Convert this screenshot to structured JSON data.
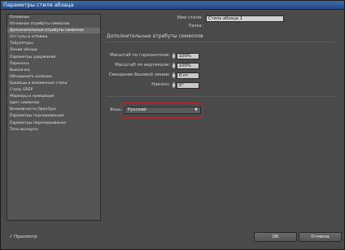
{
  "window": {
    "title": "Параметры стиля абзаца"
  },
  "sidebar": {
    "items": [
      {
        "label": "Основные"
      },
      {
        "label": "Основные атрибуты символов"
      },
      {
        "label": "Дополнительные атрибуты символов",
        "selected": true
      },
      {
        "label": "Отступы и отбивки"
      },
      {
        "label": "Табуляторы"
      },
      {
        "label": "Линии абзаца"
      },
      {
        "label": "Параметры удержания"
      },
      {
        "label": "Переносы"
      },
      {
        "label": "Выключка"
      },
      {
        "label": "Объединить колонки"
      },
      {
        "label": "Буквицы и вложенные стили"
      },
      {
        "label": "Стиль GREP"
      },
      {
        "label": "Маркеры и нумерация"
      },
      {
        "label": "Цвет символов"
      },
      {
        "label": "Возможности OpenType"
      },
      {
        "label": "Параметры подчеркивания"
      },
      {
        "label": "Параметры перечеркивания"
      },
      {
        "label": "Теги экспорта"
      }
    ]
  },
  "general": {
    "style_name_label": "Имя стиля:",
    "style_name_value": "Стиль абзаца 1",
    "location_label": "Папка:",
    "section_title": "Дополнительные атрибуты символов"
  },
  "fields": {
    "hscale": {
      "label": "Масштаб по горизонтали:",
      "value": "100%"
    },
    "vscale": {
      "label": "Масштаб по вертикали:",
      "value": "100%"
    },
    "baseline": {
      "label": "Смещение базовой линии:",
      "value": "0 пт"
    },
    "skew": {
      "label": "Наклон:",
      "value": "0°"
    }
  },
  "language": {
    "label": "Язык:",
    "value": "Русский",
    "highlight_color": "#b8252c"
  },
  "footer": {
    "preview_label": "Просмотр",
    "preview_checked": true,
    "ok_label": "OK",
    "cancel_label": "Отмена"
  }
}
